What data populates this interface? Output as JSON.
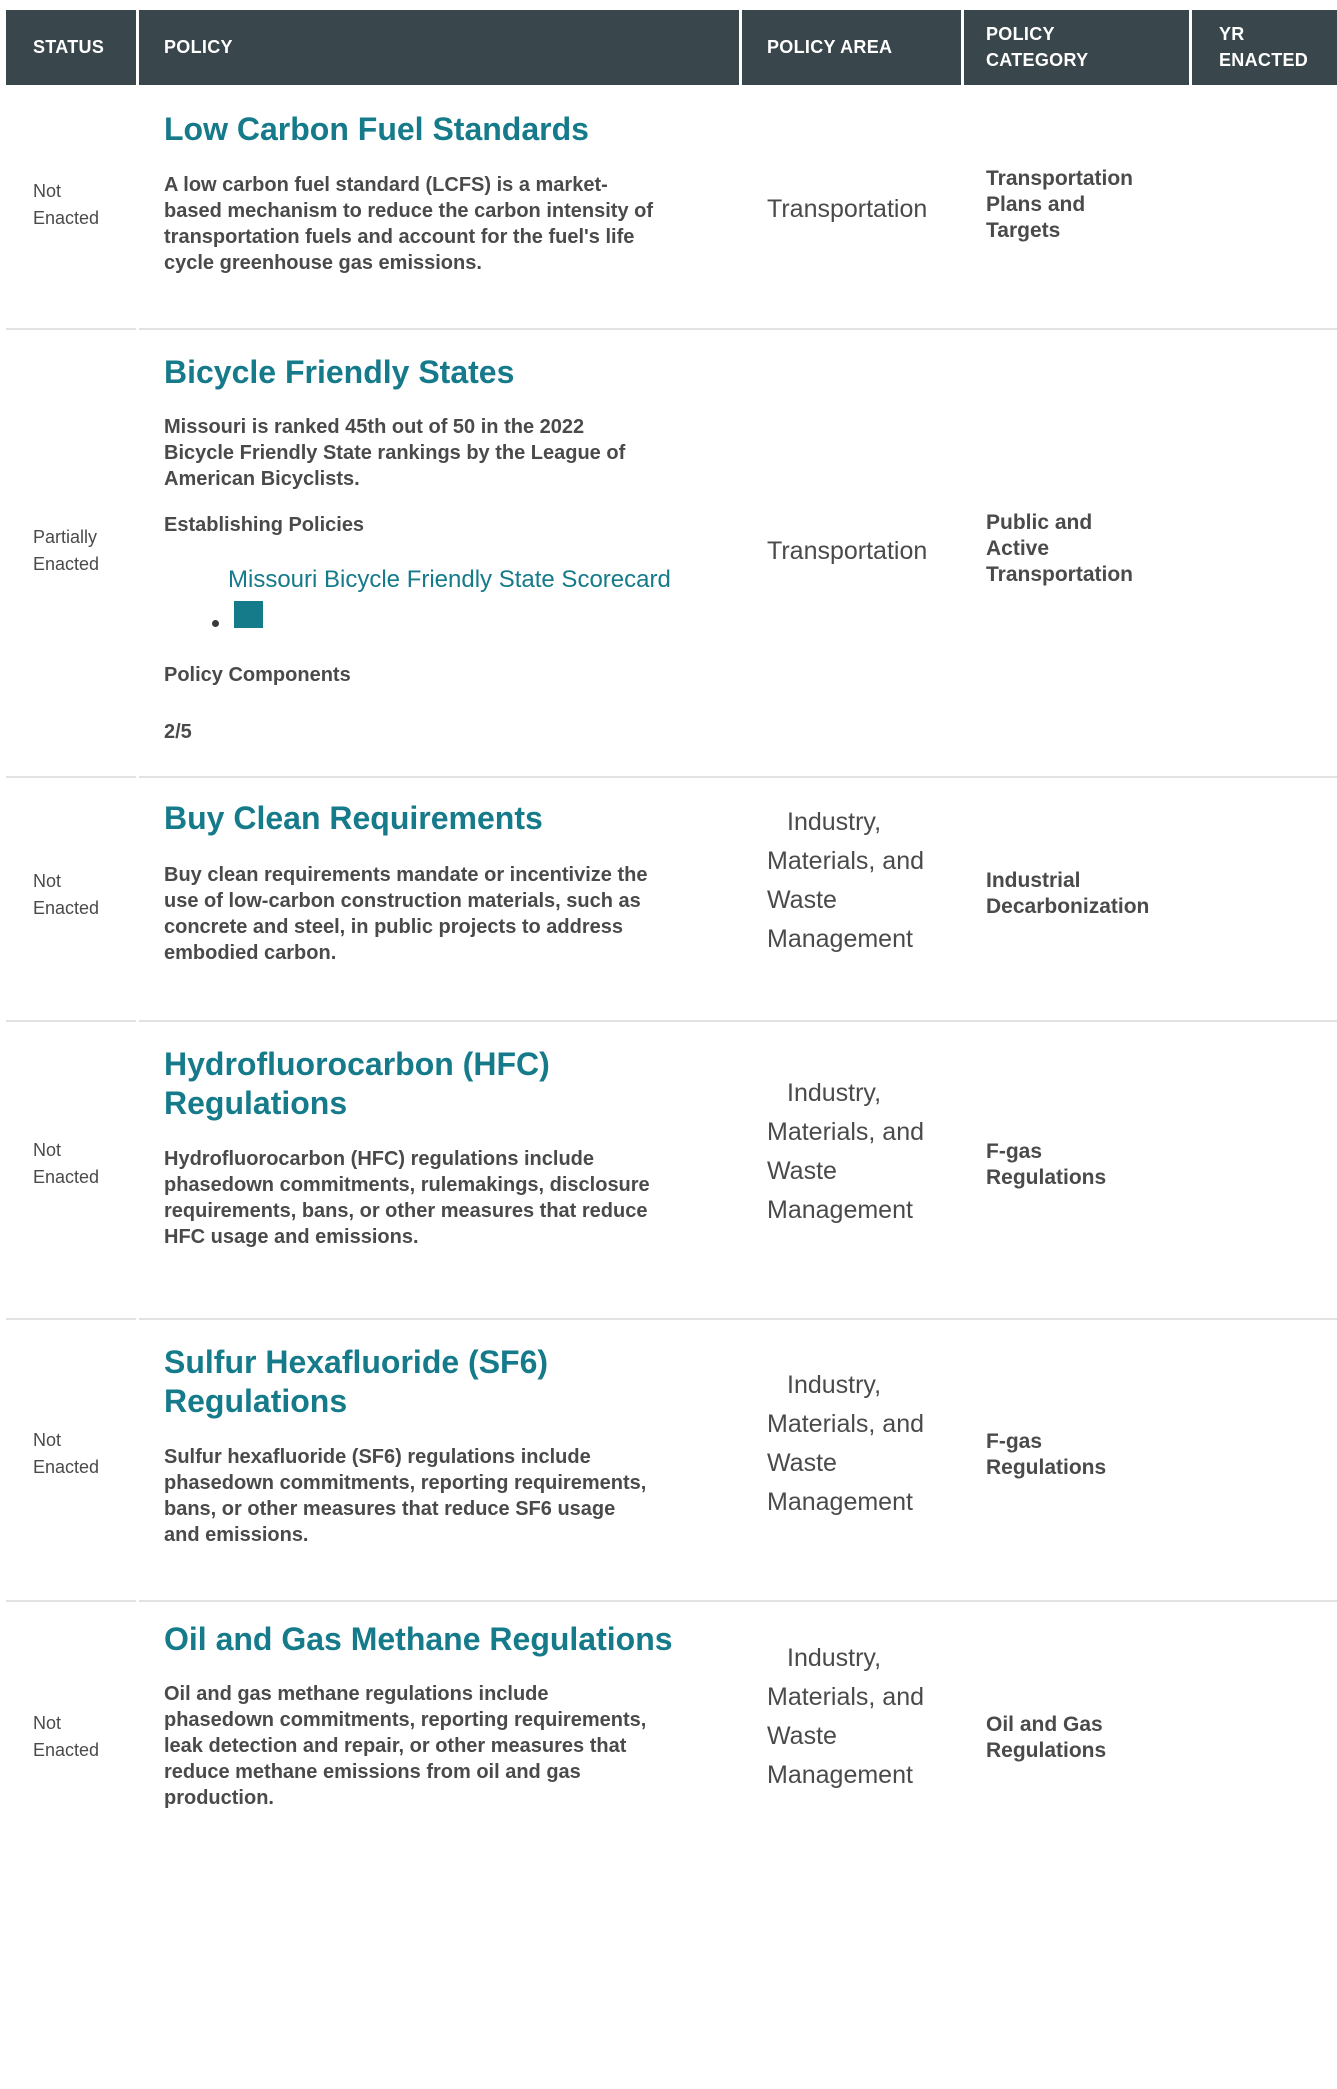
{
  "header": {
    "status": "STATUS",
    "policy": "POLICY",
    "area": "POLICY AREA",
    "category_1": "POLICY",
    "category_2": "CATEGORY",
    "yr_1": "YR",
    "yr_2": "ENACTED"
  },
  "rows": [
    {
      "status_1": "Not",
      "status_2": "Enacted",
      "title": "Low Carbon Fuel Standards",
      "desc": [
        "A low carbon fuel standard (LCFS) is a market-",
        "based mechanism to reduce the carbon intensity of",
        "transportation fuels and account for the fuel's life",
        "cycle greenhouse gas emissions."
      ],
      "area": [
        "Transportation"
      ],
      "category": [
        "Transportation",
        "Plans and",
        "Targets"
      ]
    },
    {
      "status_1": "Partially",
      "status_2": "Enacted",
      "title": "Bicycle Friendly States",
      "desc": [
        "Missouri is ranked 45th out of 50 in the 2022",
        "Bicycle Friendly State rankings by the League of",
        "American Bicyclists."
      ],
      "sub1": "Establishing Policies",
      "link": "Missouri Bicycle Friendly State Scorecard",
      "sub2": "Policy Components",
      "score": "2/5",
      "area": [
        "Transportation"
      ],
      "category": [
        "Public and",
        "Active",
        "Transportation"
      ]
    },
    {
      "status_1": "Not",
      "status_2": "Enacted",
      "title": "Buy Clean Requirements",
      "desc": [
        "Buy clean requirements mandate or incentivize the",
        "use of low-carbon construction materials, such as",
        "concrete and steel, in public projects to address",
        "embodied carbon."
      ],
      "area": [
        "Industry,",
        "Materials, and",
        "Waste",
        "Management"
      ],
      "category": [
        "Industrial",
        "Decarbonization"
      ]
    },
    {
      "status_1": "Not",
      "status_2": "Enacted",
      "title_1": "Hydrofluorocarbon (HFC)",
      "title_2": "Regulations",
      "desc": [
        "Hydrofluorocarbon (HFC) regulations include",
        "phasedown commitments, rulemakings, disclosure",
        "requirements, bans, or other measures that reduce",
        "HFC usage and emissions."
      ],
      "area": [
        "Industry,",
        "Materials, and",
        "Waste",
        "Management"
      ],
      "category": [
        "F-gas",
        "Regulations"
      ]
    },
    {
      "status_1": "Not",
      "status_2": "Enacted",
      "title_1": "Sulfur Hexafluoride (SF6)",
      "title_2": "Regulations",
      "desc": [
        "Sulfur hexafluoride (SF6) regulations include",
        "phasedown commitments, reporting requirements,",
        "bans, or other measures that reduce SF6 usage",
        "and emissions."
      ],
      "area": [
        "Industry,",
        "Materials, and",
        "Waste",
        "Management"
      ],
      "category": [
        "F-gas",
        "Regulations"
      ]
    },
    {
      "status_1": "Not",
      "status_2": "Enacted",
      "title": "Oil and Gas Methane Regulations",
      "desc": [
        "Oil and gas methane regulations include",
        "phasedown commitments, reporting requirements,",
        "leak detection and repair, or other measures that",
        "reduce methane emissions from oil and gas",
        "production."
      ],
      "area": [
        "Industry,",
        "Materials, and",
        "Waste",
        "Management"
      ],
      "category": [
        "Oil and Gas",
        "Regulations"
      ]
    }
  ]
}
